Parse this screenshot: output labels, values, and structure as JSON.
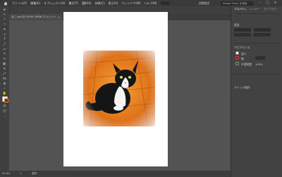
{
  "menubar": {
    "items": [
      "ファイル(F)",
      "編集(E)",
      "オブジェクト(O)",
      "書式(T)",
      "選択(S)",
      "効果(C)",
      "表示(V)",
      "ウィンドウ(W)",
      "ヘルプ(H)"
    ],
    "workspace": "初期設定",
    "search_placeholder": "Adobe Stock を検索"
  },
  "document": {
    "tab_title": "ねこ.psd @ 50.8% (RGB/プレビュー)",
    "close_glyph": "×"
  },
  "status": {
    "zoom": "50.8%",
    "page": "1",
    "mode": "選択"
  },
  "panel": {
    "tabs": [
      "プロパティ",
      "レイヤー",
      "ライブラリ"
    ],
    "sections": {
      "transform": "変形",
      "appearance": "アピアランス",
      "fill_label": "塗り",
      "stroke_label": "線",
      "opacity_label": "不透明度",
      "opacity_value": "100%",
      "quick_actions": "クイック操作"
    }
  },
  "colors": {
    "accent": "#e8801e",
    "ui_dark": "#3a3a3a",
    "canvas": "#535353"
  }
}
